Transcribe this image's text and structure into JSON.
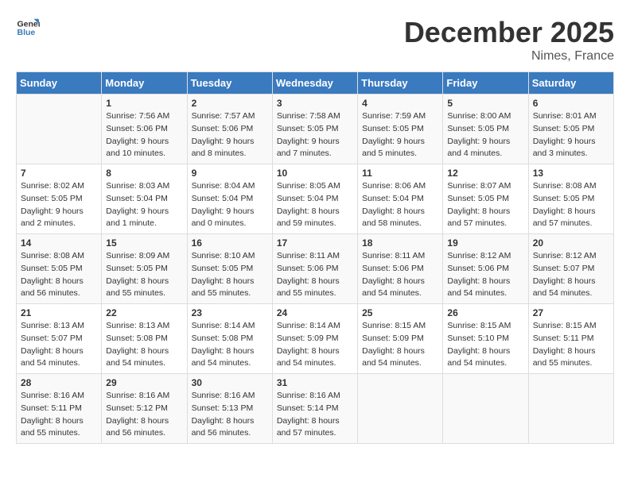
{
  "header": {
    "logo_line1": "General",
    "logo_line2": "Blue",
    "month_title": "December 2025",
    "location": "Nimes, France"
  },
  "days_of_week": [
    "Sunday",
    "Monday",
    "Tuesday",
    "Wednesday",
    "Thursday",
    "Friday",
    "Saturday"
  ],
  "weeks": [
    [
      {
        "day": "",
        "info": ""
      },
      {
        "day": "1",
        "info": "Sunrise: 7:56 AM\nSunset: 5:06 PM\nDaylight: 9 hours\nand 10 minutes."
      },
      {
        "day": "2",
        "info": "Sunrise: 7:57 AM\nSunset: 5:06 PM\nDaylight: 9 hours\nand 8 minutes."
      },
      {
        "day": "3",
        "info": "Sunrise: 7:58 AM\nSunset: 5:05 PM\nDaylight: 9 hours\nand 7 minutes."
      },
      {
        "day": "4",
        "info": "Sunrise: 7:59 AM\nSunset: 5:05 PM\nDaylight: 9 hours\nand 5 minutes."
      },
      {
        "day": "5",
        "info": "Sunrise: 8:00 AM\nSunset: 5:05 PM\nDaylight: 9 hours\nand 4 minutes."
      },
      {
        "day": "6",
        "info": "Sunrise: 8:01 AM\nSunset: 5:05 PM\nDaylight: 9 hours\nand 3 minutes."
      }
    ],
    [
      {
        "day": "7",
        "info": "Sunrise: 8:02 AM\nSunset: 5:05 PM\nDaylight: 9 hours\nand 2 minutes."
      },
      {
        "day": "8",
        "info": "Sunrise: 8:03 AM\nSunset: 5:04 PM\nDaylight: 9 hours\nand 1 minute."
      },
      {
        "day": "9",
        "info": "Sunrise: 8:04 AM\nSunset: 5:04 PM\nDaylight: 9 hours\nand 0 minutes."
      },
      {
        "day": "10",
        "info": "Sunrise: 8:05 AM\nSunset: 5:04 PM\nDaylight: 8 hours\nand 59 minutes."
      },
      {
        "day": "11",
        "info": "Sunrise: 8:06 AM\nSunset: 5:04 PM\nDaylight: 8 hours\nand 58 minutes."
      },
      {
        "day": "12",
        "info": "Sunrise: 8:07 AM\nSunset: 5:05 PM\nDaylight: 8 hours\nand 57 minutes."
      },
      {
        "day": "13",
        "info": "Sunrise: 8:08 AM\nSunset: 5:05 PM\nDaylight: 8 hours\nand 57 minutes."
      }
    ],
    [
      {
        "day": "14",
        "info": "Sunrise: 8:08 AM\nSunset: 5:05 PM\nDaylight: 8 hours\nand 56 minutes."
      },
      {
        "day": "15",
        "info": "Sunrise: 8:09 AM\nSunset: 5:05 PM\nDaylight: 8 hours\nand 55 minutes."
      },
      {
        "day": "16",
        "info": "Sunrise: 8:10 AM\nSunset: 5:05 PM\nDaylight: 8 hours\nand 55 minutes."
      },
      {
        "day": "17",
        "info": "Sunrise: 8:11 AM\nSunset: 5:06 PM\nDaylight: 8 hours\nand 55 minutes."
      },
      {
        "day": "18",
        "info": "Sunrise: 8:11 AM\nSunset: 5:06 PM\nDaylight: 8 hours\nand 54 minutes."
      },
      {
        "day": "19",
        "info": "Sunrise: 8:12 AM\nSunset: 5:06 PM\nDaylight: 8 hours\nand 54 minutes."
      },
      {
        "day": "20",
        "info": "Sunrise: 8:12 AM\nSunset: 5:07 PM\nDaylight: 8 hours\nand 54 minutes."
      }
    ],
    [
      {
        "day": "21",
        "info": "Sunrise: 8:13 AM\nSunset: 5:07 PM\nDaylight: 8 hours\nand 54 minutes."
      },
      {
        "day": "22",
        "info": "Sunrise: 8:13 AM\nSunset: 5:08 PM\nDaylight: 8 hours\nand 54 minutes."
      },
      {
        "day": "23",
        "info": "Sunrise: 8:14 AM\nSunset: 5:08 PM\nDaylight: 8 hours\nand 54 minutes."
      },
      {
        "day": "24",
        "info": "Sunrise: 8:14 AM\nSunset: 5:09 PM\nDaylight: 8 hours\nand 54 minutes."
      },
      {
        "day": "25",
        "info": "Sunrise: 8:15 AM\nSunset: 5:09 PM\nDaylight: 8 hours\nand 54 minutes."
      },
      {
        "day": "26",
        "info": "Sunrise: 8:15 AM\nSunset: 5:10 PM\nDaylight: 8 hours\nand 54 minutes."
      },
      {
        "day": "27",
        "info": "Sunrise: 8:15 AM\nSunset: 5:11 PM\nDaylight: 8 hours\nand 55 minutes."
      }
    ],
    [
      {
        "day": "28",
        "info": "Sunrise: 8:16 AM\nSunset: 5:11 PM\nDaylight: 8 hours\nand 55 minutes."
      },
      {
        "day": "29",
        "info": "Sunrise: 8:16 AM\nSunset: 5:12 PM\nDaylight: 8 hours\nand 56 minutes."
      },
      {
        "day": "30",
        "info": "Sunrise: 8:16 AM\nSunset: 5:13 PM\nDaylight: 8 hours\nand 56 minutes."
      },
      {
        "day": "31",
        "info": "Sunrise: 8:16 AM\nSunset: 5:14 PM\nDaylight: 8 hours\nand 57 minutes."
      },
      {
        "day": "",
        "info": ""
      },
      {
        "day": "",
        "info": ""
      },
      {
        "day": "",
        "info": ""
      }
    ]
  ]
}
